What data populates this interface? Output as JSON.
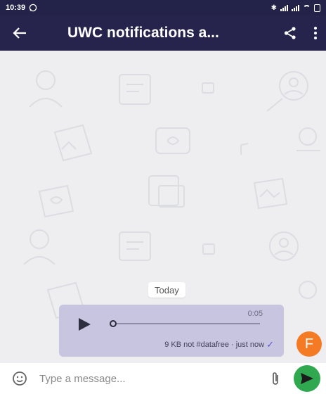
{
  "status_bar": {
    "time": "10:39",
    "notification_icon": "whatsapp-icon"
  },
  "header": {
    "title": "UWC notifications a...",
    "back_icon": "arrow-left-icon",
    "share_icon": "share-icon",
    "more_icon": "more-vert-icon",
    "bg_color": "#26244d"
  },
  "chat": {
    "date_separator": "Today",
    "message": {
      "type": "voice",
      "duration": "0:05",
      "meta": "9 KB not #datafree · just now",
      "status_icon": "check-icon",
      "bubble_color": "#c7c5df",
      "progress": 0
    },
    "avatar_letter": "F",
    "avatar_color": "#f47a24"
  },
  "composer": {
    "placeholder": "Type a message...",
    "emoji_icon": "smiley-icon",
    "attach_icon": "paperclip-icon",
    "send_icon": "send-icon",
    "send_color": "#2fa84f"
  }
}
